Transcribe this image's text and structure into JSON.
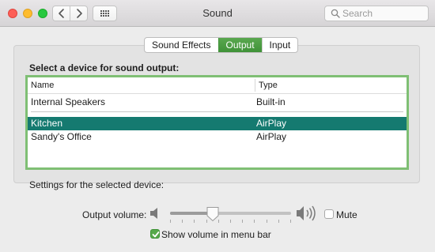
{
  "window": {
    "title": "Sound"
  },
  "toolbar": {
    "search_placeholder": "Search"
  },
  "tabs": [
    {
      "label": "Sound Effects",
      "active": false
    },
    {
      "label": "Output",
      "active": true
    },
    {
      "label": "Input",
      "active": false
    }
  ],
  "output": {
    "heading": "Select a device for sound output:",
    "columns": [
      "Name",
      "Type"
    ],
    "devices": [
      {
        "name": "Internal Speakers",
        "type": "Built-in",
        "selected": false
      },
      {
        "name": "Kitchen",
        "type": "AirPlay",
        "selected": true
      },
      {
        "name": "Sandy's Office",
        "type": "AirPlay",
        "selected": false
      }
    ],
    "settings_label": "Settings for the selected device:"
  },
  "volume": {
    "label": "Output volume:",
    "level_fraction": 0.35,
    "mute_label": "Mute",
    "mute_checked": false
  },
  "menubar": {
    "label": "Show volume in menu bar",
    "checked": true
  },
  "colors": {
    "accent_green": "#4aa040",
    "selection": "#157a70",
    "table_highlight_border": "#7fbf74"
  }
}
